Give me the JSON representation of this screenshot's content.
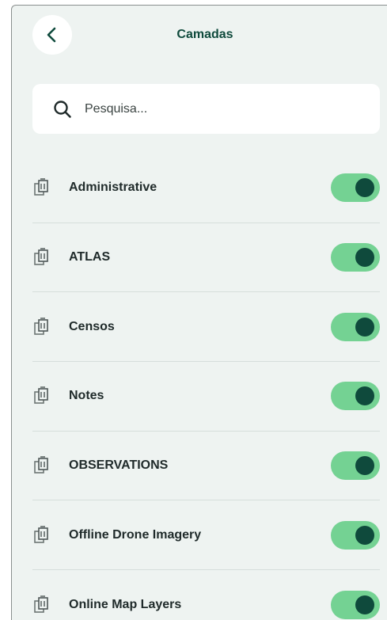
{
  "header": {
    "title": "Camadas",
    "back_icon": "chevron-left-icon"
  },
  "search": {
    "placeholder": "Pesquisa...",
    "value": "",
    "icon": "search-icon"
  },
  "layers": [
    {
      "label": "Administrative",
      "enabled": true,
      "icon": "layers-icon"
    },
    {
      "label": "ATLAS",
      "enabled": true,
      "icon": "layers-icon"
    },
    {
      "label": "Censos",
      "enabled": true,
      "icon": "layers-icon"
    },
    {
      "label": "Notes",
      "enabled": true,
      "icon": "layers-icon"
    },
    {
      "label": "OBSERVATIONS",
      "enabled": true,
      "icon": "layers-icon"
    },
    {
      "label": "Offline Drone Imagery",
      "enabled": true,
      "icon": "layers-icon"
    },
    {
      "label": "Online Map Layers",
      "enabled": true,
      "icon": "layers-icon"
    }
  ],
  "colors": {
    "background": "#eef3f1",
    "accent_dark": "#0f4a3c",
    "toggle_on": "#74d293"
  }
}
